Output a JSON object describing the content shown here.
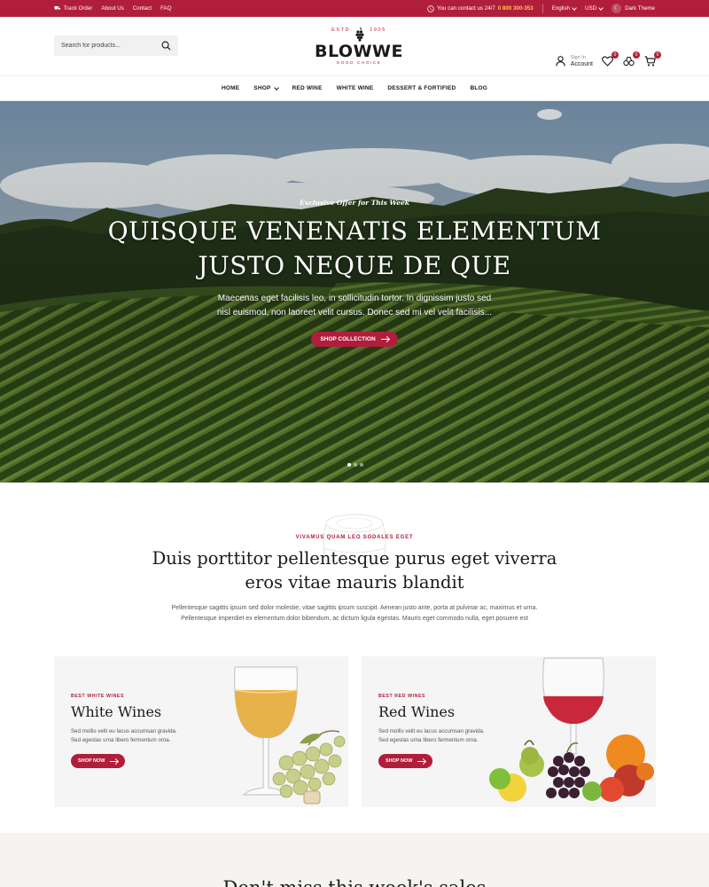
{
  "topbar": {
    "track_order": "Track Order",
    "about": "About Us",
    "contact": "Contact",
    "faq": "FAQ",
    "contact_text": "You can contact us 24/7",
    "phone": "0 800 300-353",
    "language": "English",
    "currency": "USD",
    "theme_label": "Dark Theme"
  },
  "header": {
    "search_placeholder": "Search for products...",
    "logo_estd_left": "ESTD",
    "logo_estd_right": "1905",
    "logo_name": "BLOWWE",
    "logo_tagline": "GOOD CHOICE",
    "signin": "Sign In",
    "account": "Account",
    "wishlist_count": "0",
    "compare_count": "0",
    "cart_count": "0"
  },
  "nav": {
    "home": "HOME",
    "shop": "SHOP",
    "red_wine": "RED WINE",
    "white_wine": "WHITE WINE",
    "dessert": "DESSERT & FORTIFIED",
    "blog": "BLOG"
  },
  "hero": {
    "eyebrow": "Exclusive Offer for This Week",
    "title_line1": "QUISQUE VENENATIS ELEMENTUM",
    "title_line2": "JUSTO NEQUE DE QUE",
    "text_line1": "Maecenas eget facilisis leo, in sollicitudin tortor. In dignissim justo sed",
    "text_line2": "nisl euismod, non laoreet velit cursus. Donec sed mi vel velit facilisis...",
    "button": "SHOP COLLECTION"
  },
  "intro": {
    "eyebrow": "VIVAMUS QUAM LEO SODALES EGET",
    "title_line1": "Duis porttitor pellentesque purus eget viverra",
    "title_line2": "eros vitae mauris blandit",
    "text_line1": "Pellentesque sagittis ipsum sed dolor molestie, vitae sagittis ipsum suscipit. Aenean justo ante, porta at pulvinar ac, maximus et urna.",
    "text_line2": "Pellentesque imperdiet ex elementum dolor bibendum, ac dictum ligula egestas. Mauris eget commodo nulla, eget posuere est"
  },
  "cards": [
    {
      "eyebrow": "BEST WHITE WINES",
      "title": "White Wines",
      "desc_line1": "Sed mollis velit eu lacus accumsan gravida.",
      "desc_line2": "Sed egestas urna libero fermentum orna.",
      "button": "SHOP NOW"
    },
    {
      "eyebrow": "BEST RED WINES",
      "title": "Red Wines",
      "desc_line1": "Sed mollis velit eu lacus accumsan gravida.",
      "desc_line2": "Sed egestas urna libero fermentum orna.",
      "button": "SHOP NOW"
    }
  ],
  "bottom": {
    "title": "Don't miss this week's sales"
  },
  "colors": {
    "brand": "#b01e3b",
    "phone_highlight": "#ffc94a"
  },
  "icons": [
    "truck-icon",
    "phone-icon",
    "search-icon",
    "user-icon",
    "heart-icon",
    "compare-icon",
    "cart-icon",
    "arrow-right-icon",
    "moon-icon"
  ]
}
